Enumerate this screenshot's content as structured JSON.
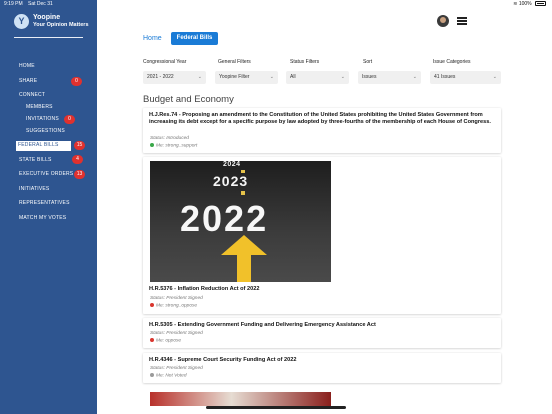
{
  "status_bar": {
    "time": "9:19 PM",
    "date": "Sat Dec 31",
    "battery": "100%"
  },
  "brand": {
    "name": "Yoopine",
    "tagline": "Your Opinion Matters",
    "logo_glyph": "Y"
  },
  "sidebar": {
    "items": [
      {
        "label": "HOME"
      },
      {
        "label": "SHARE",
        "badge": "0"
      },
      {
        "label": "CONNECT"
      },
      {
        "label": "MEMBERS"
      },
      {
        "label": "INVITATIONS",
        "badge": "0"
      },
      {
        "label": "SUGGESTIONS"
      },
      {
        "label": "FEDERAL BILLS",
        "badge": "15",
        "active": true
      },
      {
        "label": "STATE BILLS",
        "badge": "4"
      },
      {
        "label": "EXECUTIVE ORDERS",
        "badge": "13"
      },
      {
        "label": "INITIATIVES"
      },
      {
        "label": "REPRESENTATIVES"
      },
      {
        "label": "MATCH MY VOTES"
      }
    ]
  },
  "breadcrumb": {
    "home": "Home",
    "current": "Federal Bills"
  },
  "filters": [
    {
      "label": "Congressional Year",
      "value": "2021 - 2022"
    },
    {
      "label": "General Filters",
      "value": "Yoopine Filter"
    },
    {
      "label": "Status Filters",
      "value": "All"
    },
    {
      "label": "Sort",
      "value": "Issues"
    },
    {
      "label": "Issue Categories",
      "value": "41 Issues"
    }
  ],
  "section_title": "Budget and Economy",
  "bills": [
    {
      "title": "H.J.Res.74 - Proposing an amendment to the Constitution of the United States prohibiting the United States Government from increasing its debt except for a specific purpose by law adopted by three-fourths of the membership of each House of Congress.",
      "status": "Status: Introduced",
      "vote": "Me: strong_support",
      "vote_color": "#3aa84a"
    },
    {
      "title": "H.R.5376 - Inflation Reduction Act of 2022",
      "status": "Status: President Signed",
      "vote": "Me: strong_oppose",
      "vote_color": "#d9362f",
      "image_text": {
        "y1": "2024",
        "y2": "2023",
        "y3": "2022"
      }
    },
    {
      "title": "H.R.5305 - Extending Government Funding and Delivering Emergency Assistance Act",
      "status": "Status: President Signed",
      "vote": "Me: oppose",
      "vote_color": "#d9362f"
    },
    {
      "title": "H.R.4346 - Supreme Court Security Funding Act of 2022",
      "status": "Status: President Signed",
      "vote": "Me: Not Voted",
      "vote_color": "#9a9a9a"
    }
  ]
}
